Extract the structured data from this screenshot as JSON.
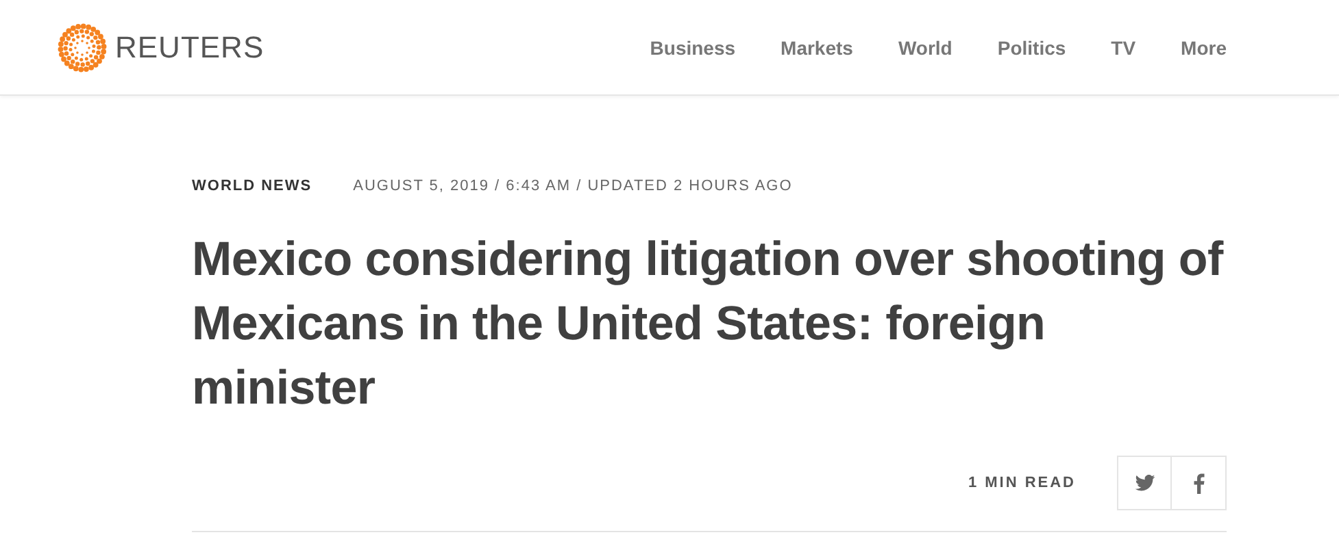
{
  "header": {
    "brand": "REUTERS",
    "nav": [
      {
        "label": "Business"
      },
      {
        "label": "Markets"
      },
      {
        "label": "World"
      },
      {
        "label": "Politics"
      },
      {
        "label": "TV"
      },
      {
        "label": "More"
      }
    ]
  },
  "article": {
    "section": "WORLD NEWS",
    "dateline": "AUGUST 5, 2019 / 6:43 AM / UPDATED 2 HOURS AGO",
    "headline": "Mexico considering litigation over shooting of Mexicans in the United States: foreign minister",
    "read_time": "1 MIN READ",
    "share": [
      {
        "kind": "twitter"
      },
      {
        "kind": "facebook"
      }
    ]
  }
}
